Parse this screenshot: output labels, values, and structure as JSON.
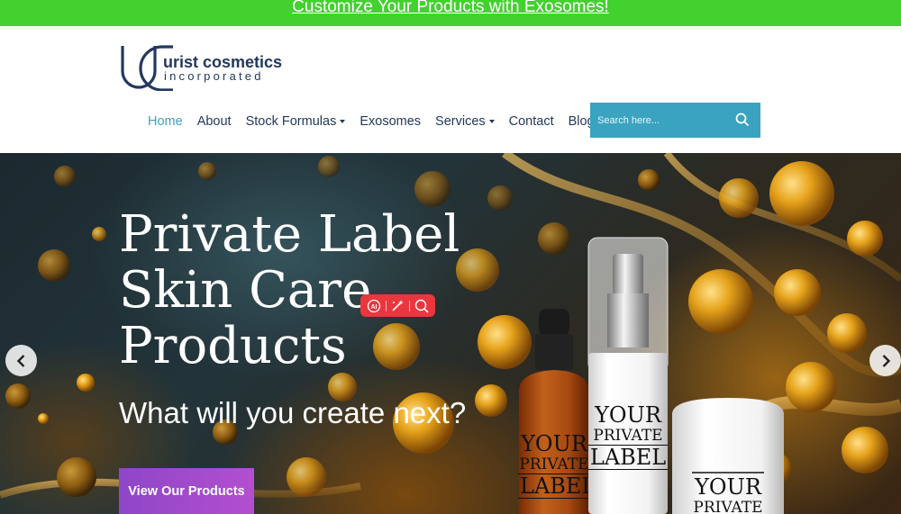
{
  "topbar": {
    "link_text": "Customize Your Products with Exosomes!"
  },
  "logo": {
    "line1": "urist cosmetics",
    "line2": "incorporated"
  },
  "nav": {
    "items": [
      {
        "label": "Home",
        "active": true,
        "dropdown": false
      },
      {
        "label": "About",
        "active": false,
        "dropdown": false
      },
      {
        "label": "Stock Formulas",
        "active": false,
        "dropdown": true
      },
      {
        "label": "Exosomes",
        "active": false,
        "dropdown": false
      },
      {
        "label": "Services",
        "active": false,
        "dropdown": true
      },
      {
        "label": "Contact",
        "active": false,
        "dropdown": false
      },
      {
        "label": "Blog",
        "active": false,
        "dropdown": false
      }
    ]
  },
  "search": {
    "placeholder": "Search here..."
  },
  "hero": {
    "title_line1": "Private Label",
    "title_line2": "Skin Care",
    "title_line3": "Products",
    "subtitle": "What will you create next?",
    "cta_label": "View Our Products"
  },
  "products": {
    "dropper": {
      "your": "YOUR",
      "private": "PRIVATE",
      "label": "LABEL"
    },
    "pump": {
      "your": "YOUR",
      "private": "PRIVATE",
      "label": "LABEL"
    },
    "jar": {
      "your": "YOUR",
      "private": "PRIVATE"
    }
  },
  "colors": {
    "topbar_green": "#43d12f",
    "brand_navy": "#22385f",
    "accent_teal": "#3aa3c0",
    "cta_purple": "#a04bcb",
    "ai_red": "#e9373e"
  },
  "icons": {
    "search": "search-icon",
    "prev": "chevron-left-icon",
    "next": "chevron-right-icon",
    "ai_tools": [
      "ai-icon",
      "magic-wand-icon",
      "lens-icon"
    ]
  }
}
